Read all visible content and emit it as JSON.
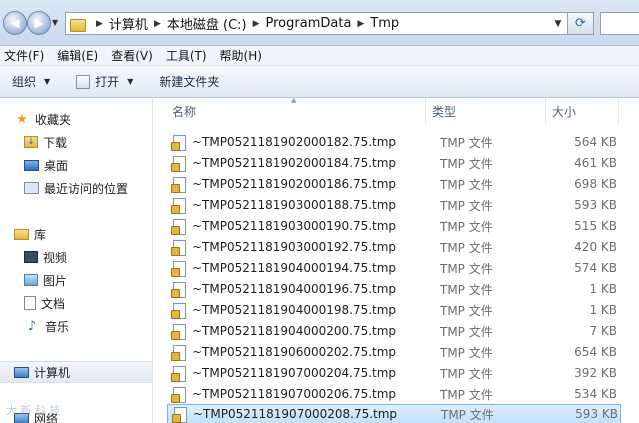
{
  "address": {
    "crumbs": [
      "计算机",
      "本地磁盘 (C:)",
      "ProgramData",
      "Tmp"
    ]
  },
  "menu": [
    "文件(F)",
    "编辑(E)",
    "查看(V)",
    "工具(T)",
    "帮助(H)"
  ],
  "toolbar": {
    "organize": "组织",
    "open": "打开",
    "new_folder": "新建文件夹"
  },
  "nav": {
    "favorites": "收藏夹",
    "downloads": "下载",
    "desktop": "桌面",
    "recent": "最近访问的位置",
    "libraries": "库",
    "videos": "视频",
    "pictures": "图片",
    "documents": "文档",
    "music": "音乐",
    "computer": "计算机",
    "network": "网络"
  },
  "columns": {
    "name": "名称",
    "type": "类型",
    "size": "大小"
  },
  "files": [
    {
      "name": "~TMP0521181902000182.75.tmp",
      "type": "TMP 文件",
      "size": "564 KB"
    },
    {
      "name": "~TMP0521181902000184.75.tmp",
      "type": "TMP 文件",
      "size": "461 KB"
    },
    {
      "name": "~TMP0521181902000186.75.tmp",
      "type": "TMP 文件",
      "size": "698 KB"
    },
    {
      "name": "~TMP0521181903000188.75.tmp",
      "type": "TMP 文件",
      "size": "593 KB"
    },
    {
      "name": "~TMP0521181903000190.75.tmp",
      "type": "TMP 文件",
      "size": "515 KB"
    },
    {
      "name": "~TMP0521181903000192.75.tmp",
      "type": "TMP 文件",
      "size": "420 KB"
    },
    {
      "name": "~TMP0521181904000194.75.tmp",
      "type": "TMP 文件",
      "size": "574 KB"
    },
    {
      "name": "~TMP0521181904000196.75.tmp",
      "type": "TMP 文件",
      "size": "1 KB"
    },
    {
      "name": "~TMP0521181904000198.75.tmp",
      "type": "TMP 文件",
      "size": "1 KB"
    },
    {
      "name": "~TMP0521181904000200.75.tmp",
      "type": "TMP 文件",
      "size": "7 KB"
    },
    {
      "name": "~TMP0521181906000202.75.tmp",
      "type": "TMP 文件",
      "size": "654 KB"
    },
    {
      "name": "~TMP0521181907000204.75.tmp",
      "type": "TMP 文件",
      "size": "392 KB"
    },
    {
      "name": "~TMP0521181907000206.75.tmp",
      "type": "TMP 文件",
      "size": "534 KB"
    },
    {
      "name": "~TMP0521181907000208.75.tmp",
      "type": "TMP 文件",
      "size": "593 KB"
    }
  ],
  "watermark": "大 新 科 技"
}
